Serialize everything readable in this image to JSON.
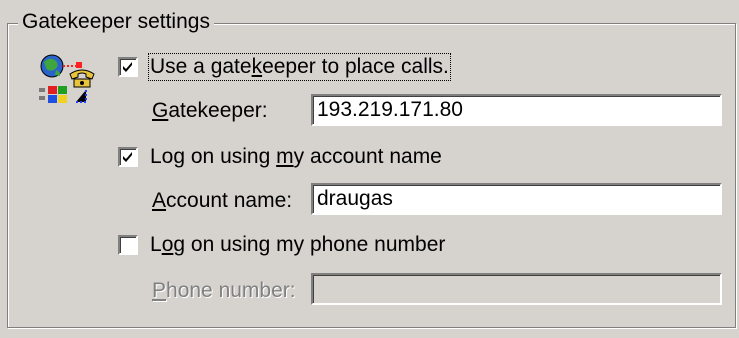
{
  "group": {
    "title": "Gatekeeper settings"
  },
  "use_gatekeeper": {
    "checked": true,
    "label_pre": "Use a gate",
    "label_mn": "k",
    "label_post": "eeper to place calls."
  },
  "gatekeeper": {
    "label_mn": "G",
    "label_post": "atekeeper:",
    "value": "193.219.171.80"
  },
  "logon_account": {
    "checked": true,
    "label_pre": "Log on using ",
    "label_mn": "m",
    "label_post": "y account name"
  },
  "account_name": {
    "label_mn": "A",
    "label_post": "ccount name:",
    "value": "draugas"
  },
  "logon_phone": {
    "checked": false,
    "label_pre": "L",
    "label_mn": "o",
    "label_post": "g on using my phone number"
  },
  "phone_number": {
    "label_mn": "P",
    "label_post": "hone number:",
    "value": "",
    "disabled": true
  },
  "colors": {
    "dialog_bg": "#d6d3ce",
    "disabled_text": "#808080"
  },
  "icons": {
    "app": "gatekeeper-network-icon",
    "check": "checkmark-icon"
  }
}
